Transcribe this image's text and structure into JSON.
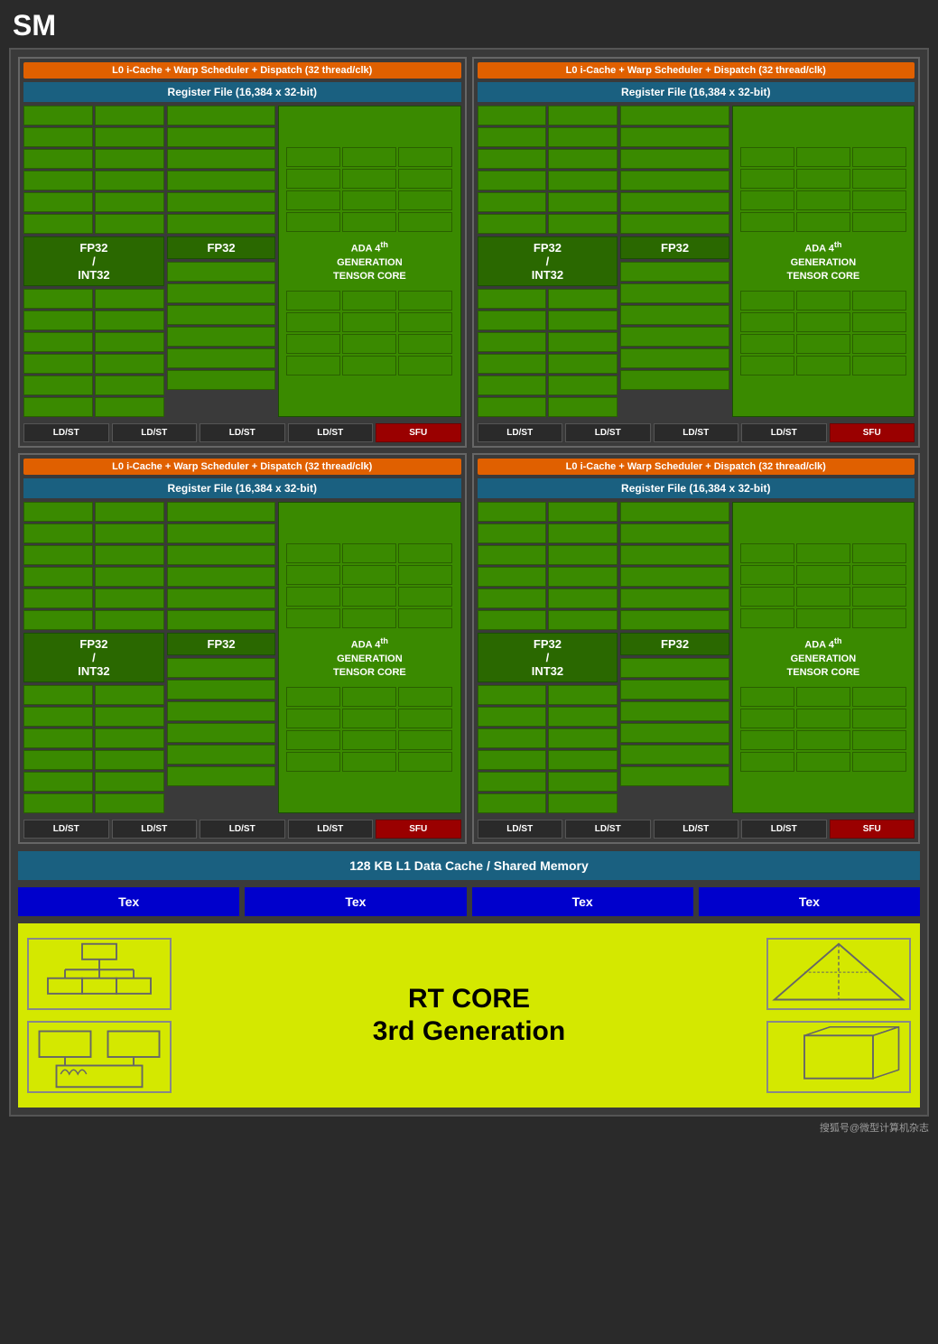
{
  "title": "SM",
  "warp_scheduler": {
    "label": "L0 i-Cache + Warp Scheduler + Dispatch (32 thread/clk)"
  },
  "register_file": {
    "label": "Register File (16,384 x 32-bit)"
  },
  "cores": {
    "fp32_int32_label": "FP32\n/\nINT32",
    "fp32_label": "FP32",
    "tensor_label": "ADA 4th GENERATION TENSOR CORE"
  },
  "ldst_sfu": {
    "ldst": "LD/ST",
    "sfu": "SFU"
  },
  "l1_cache": {
    "label": "128 KB L1 Data Cache / Shared Memory"
  },
  "tex": {
    "label": "Tex"
  },
  "rt_core": {
    "label": "RT CORE\n3rd Generation"
  },
  "watermark": "搜狐号@微型计算机杂志"
}
